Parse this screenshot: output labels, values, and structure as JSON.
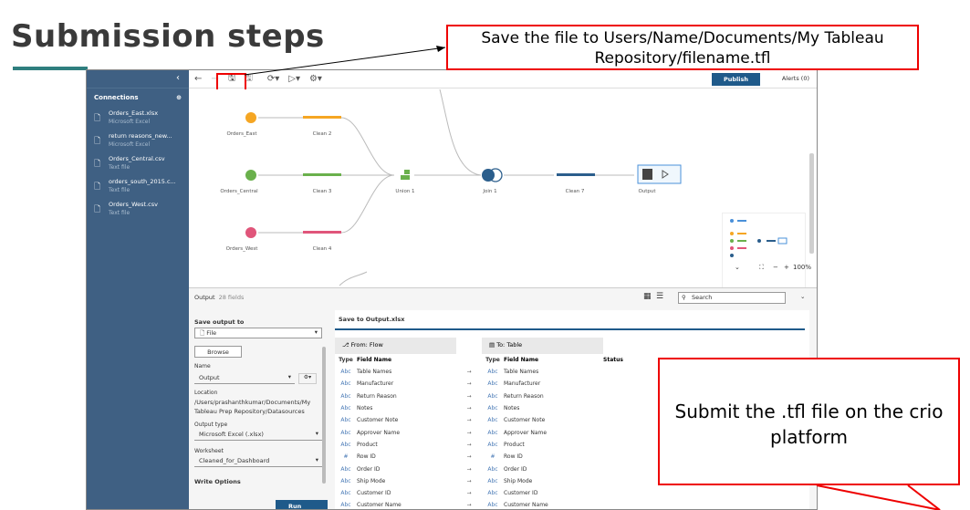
{
  "slide": {
    "title": "Submission steps",
    "callout_top": "Save the file to Users/Name/Documents/My Tableau Repository/filename.tfl",
    "callout_bottom": "Submit the .tfl file on the crio platform"
  },
  "app": {
    "toolbar": {
      "publish": "Publish",
      "alerts": "Alerts (0)"
    },
    "sidebar": {
      "heading": "Connections",
      "items": [
        {
          "name": "Orders_East.xlsx",
          "type": "Microsoft Excel"
        },
        {
          "name": "return reasons_new...",
          "type": "Microsoft Excel"
        },
        {
          "name": "Orders_Central.csv",
          "type": "Text file"
        },
        {
          "name": "orders_south_2015.c...",
          "type": "Text file"
        },
        {
          "name": "Orders_West.csv",
          "type": "Text file"
        }
      ]
    },
    "flow": {
      "nodes": {
        "orders_east": "Orders_East",
        "clean2": "Clean 2",
        "orders_central": "Orders_Central",
        "clean3": "Clean 3",
        "union1": "Union 1",
        "join1": "Join 1",
        "clean7": "Clean 7",
        "output": "Output",
        "orders_west": "Orders_West",
        "clean4": "Clean 4"
      },
      "zoom": "100%"
    },
    "output_panel": {
      "title": "Output",
      "field_count": "28 fields",
      "search_placeholder": "Search",
      "save_output_to_label": "Save output to",
      "save_output_to_value": "File",
      "browse": "Browse",
      "name_label": "Name",
      "name_value": "Output",
      "location_label": "Location",
      "location_value": "/Users/prashanthkumar/Documents/My Tableau Prep Repository/Datasources",
      "output_type_label": "Output type",
      "output_type_value": "Microsoft Excel (.xlsx)",
      "worksheet_label": "Worksheet",
      "worksheet_value": "Cleaned_for_Dashboard",
      "write_options": "Write Options",
      "run_flow": "Run Flow",
      "save_to": "Save to Output.xlsx",
      "from_label": "From: Flow",
      "to_label": "To: Table",
      "col_type": "Type",
      "col_field": "Field Name",
      "col_status": "Status",
      "rows": [
        {
          "type": "Abc",
          "from": "Table Names",
          "to": "Table Names"
        },
        {
          "type": "Abc",
          "from": "Manufacturer",
          "to": "Manufacturer"
        },
        {
          "type": "Abc",
          "from": "Return Reason",
          "to": "Return Reason"
        },
        {
          "type": "Abc",
          "from": "Notes",
          "to": "Notes"
        },
        {
          "type": "Abc",
          "from": "Customer Note",
          "to": "Customer Note"
        },
        {
          "type": "Abc",
          "from": "Approver Name",
          "to": "Approver Name"
        },
        {
          "type": "Abc",
          "from": "Product",
          "to": "Product"
        },
        {
          "type": "#",
          "from": "Row ID",
          "to": "Row ID"
        },
        {
          "type": "Abc",
          "from": "Order ID",
          "to": "Order ID"
        },
        {
          "type": "Abc",
          "from": "Ship Mode",
          "to": "Ship Mode"
        },
        {
          "type": "Abc",
          "from": "Customer ID",
          "to": "Customer ID"
        },
        {
          "type": "Abc",
          "from": "Customer Name",
          "to": "Customer Name"
        }
      ]
    }
  }
}
